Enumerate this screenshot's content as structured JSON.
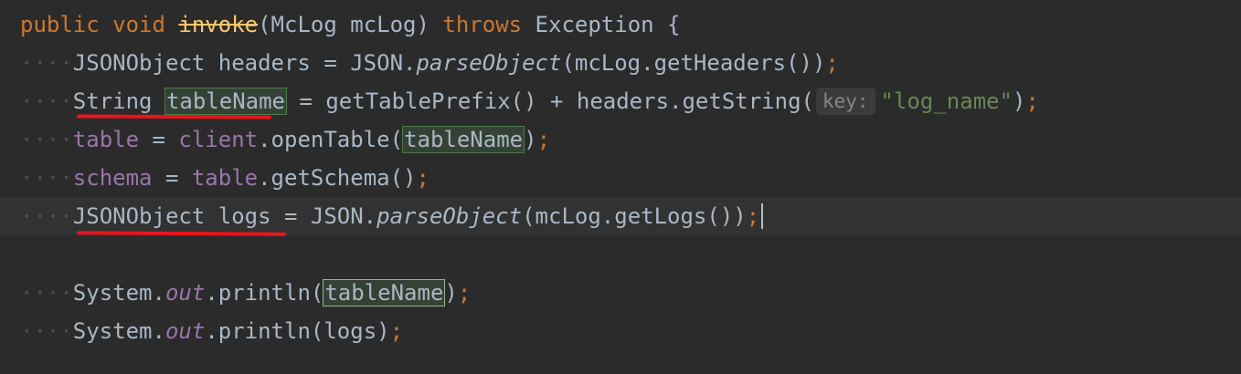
{
  "editor": {
    "lines": [
      {
        "indent": "",
        "tokens": [
          {
            "t": "public",
            "c": "kw"
          },
          {
            "t": " "
          },
          {
            "t": "void",
            "c": "kw"
          },
          {
            "t": " "
          },
          {
            "t": "invoke",
            "c": "fn-strike"
          },
          {
            "t": "(McLog mcLog) "
          },
          {
            "t": "throws",
            "c": "kw"
          },
          {
            "t": " Exception {"
          }
        ]
      },
      {
        "indent": "····",
        "tokens": [
          {
            "t": "JSONObject headers = JSON."
          },
          {
            "t": "parseObject",
            "c": "italic-fn"
          },
          {
            "t": "(mcLog.getHeaders())"
          },
          {
            "t": ";",
            "c": "punct"
          }
        ]
      },
      {
        "indent": "····",
        "tokens": [
          {
            "t": "String "
          },
          {
            "t": "tableName",
            "c": "hl"
          },
          {
            "t": " = getTablePrefix() + headers.getString("
          },
          {
            "t": "key:",
            "c": "hint"
          },
          {
            "t": "\"log_name\"",
            "c": "str"
          },
          {
            "t": ")"
          },
          {
            "t": ";",
            "c": "punct"
          }
        ]
      },
      {
        "indent": "····",
        "tokens": [
          {
            "t": "table",
            "c": "field"
          },
          {
            "t": " = "
          },
          {
            "t": "client",
            "c": "field"
          },
          {
            "t": ".openTable("
          },
          {
            "t": "tableName",
            "c": "hl"
          },
          {
            "t": ")"
          },
          {
            "t": ";",
            "c": "punct"
          }
        ]
      },
      {
        "indent": "····",
        "tokens": [
          {
            "t": "schema",
            "c": "field"
          },
          {
            "t": " = "
          },
          {
            "t": "table",
            "c": "field"
          },
          {
            "t": ".getSchema()"
          },
          {
            "t": ";",
            "c": "punct"
          }
        ]
      },
      {
        "indent": "····",
        "current": true,
        "tokens": [
          {
            "t": "JSONObject logs = JSON."
          },
          {
            "t": "parseObject",
            "c": "italic-fn"
          },
          {
            "t": "(mcLog.getLogs())"
          },
          {
            "t": ";",
            "c": "punct"
          },
          {
            "t": "",
            "c": "caret"
          }
        ]
      },
      {
        "indent": "",
        "tokens": []
      },
      {
        "indent": "····",
        "tokens": [
          {
            "t": "System."
          },
          {
            "t": "out",
            "c": "italic-field"
          },
          {
            "t": ".println("
          },
          {
            "t": "tableName",
            "c": "hl-strong"
          },
          {
            "t": ")"
          },
          {
            "t": ";",
            "c": "punct"
          }
        ]
      },
      {
        "indent": "····",
        "tokens": [
          {
            "t": "System."
          },
          {
            "t": "out",
            "c": "italic-field"
          },
          {
            "t": ".println(logs)"
          },
          {
            "t": ";",
            "c": "punct"
          }
        ]
      }
    ]
  }
}
